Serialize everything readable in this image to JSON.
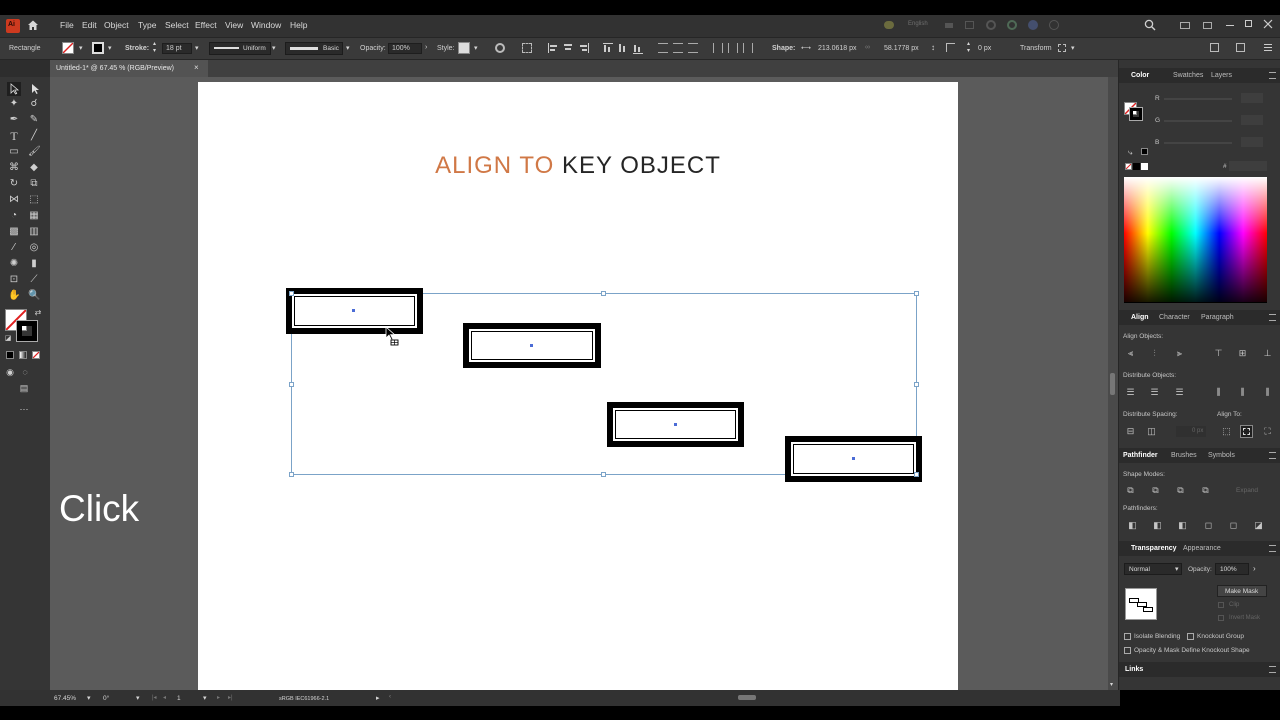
{
  "app": {
    "logo_text": "Ai",
    "language": "English"
  },
  "menu": [
    "File",
    "Edit",
    "Object",
    "Type",
    "Select",
    "Effect",
    "View",
    "Window",
    "Help"
  ],
  "control_bar": {
    "tool_name": "Rectangle",
    "stroke_label": "Stroke:",
    "stroke_value": "18 pt",
    "profile_value": "Uniform",
    "brush_value": "Basic",
    "opacity_label": "Opacity:",
    "opacity_value": "100%",
    "style_label": "Style:",
    "shape_label": "Shape:",
    "width_value": "213.0618 px",
    "height_value": "58.1778 px",
    "corner_value": "0 px",
    "transform_label": "Transform"
  },
  "document_tab": {
    "title": "Untitled-1* @ 67.45 % (RGB/Preview)"
  },
  "artboard": {
    "title_accent": "ALIGN TO",
    "title_rest": "KEY OBJECT"
  },
  "overlay": {
    "caption": "Click"
  },
  "panels": {
    "color": {
      "tabs": [
        "Color",
        "Swatches",
        "Layers"
      ],
      "channels": [
        "R",
        "G",
        "B"
      ],
      "hash": "#"
    },
    "align": {
      "tabs": [
        "Align",
        "Character",
        "Paragraph"
      ],
      "align_objects": "Align Objects:",
      "distribute_objects": "Distribute Objects:",
      "distribute_spacing": "Distribute Spacing:",
      "align_to": "Align To:",
      "spacing_value": "0 px"
    },
    "pathfinder": {
      "tabs": [
        "Pathfinder",
        "Brushes",
        "Symbols"
      ],
      "shape_modes": "Shape Modes:",
      "pathfinders": "Pathfinders:",
      "expand": "Expand"
    },
    "transparency": {
      "tabs": [
        "Transparency",
        "Appearance"
      ],
      "blend_mode": "Normal",
      "opacity_label": "Opacity:",
      "opacity_value": "100%",
      "make_mask": "Make Mask",
      "clip": "Clip",
      "invert_mask": "Invert Mask",
      "isolate_blending": "Isolate Blending",
      "knockout_group": "Knockout Group",
      "opacity_mask_knockout": "Opacity & Mask Define Knockout Shape"
    },
    "links": {
      "tab": "Links"
    }
  },
  "status_bar": {
    "zoom": "67.45%",
    "rotation": "0°",
    "artboard_number": "1",
    "color_profile": "sRGB IEC61966-2.1"
  },
  "colors": {
    "accent": "#d07846",
    "selection": "#7ba3c8",
    "ui_dark": "#323232",
    "workspace": "#5b5b5b"
  }
}
